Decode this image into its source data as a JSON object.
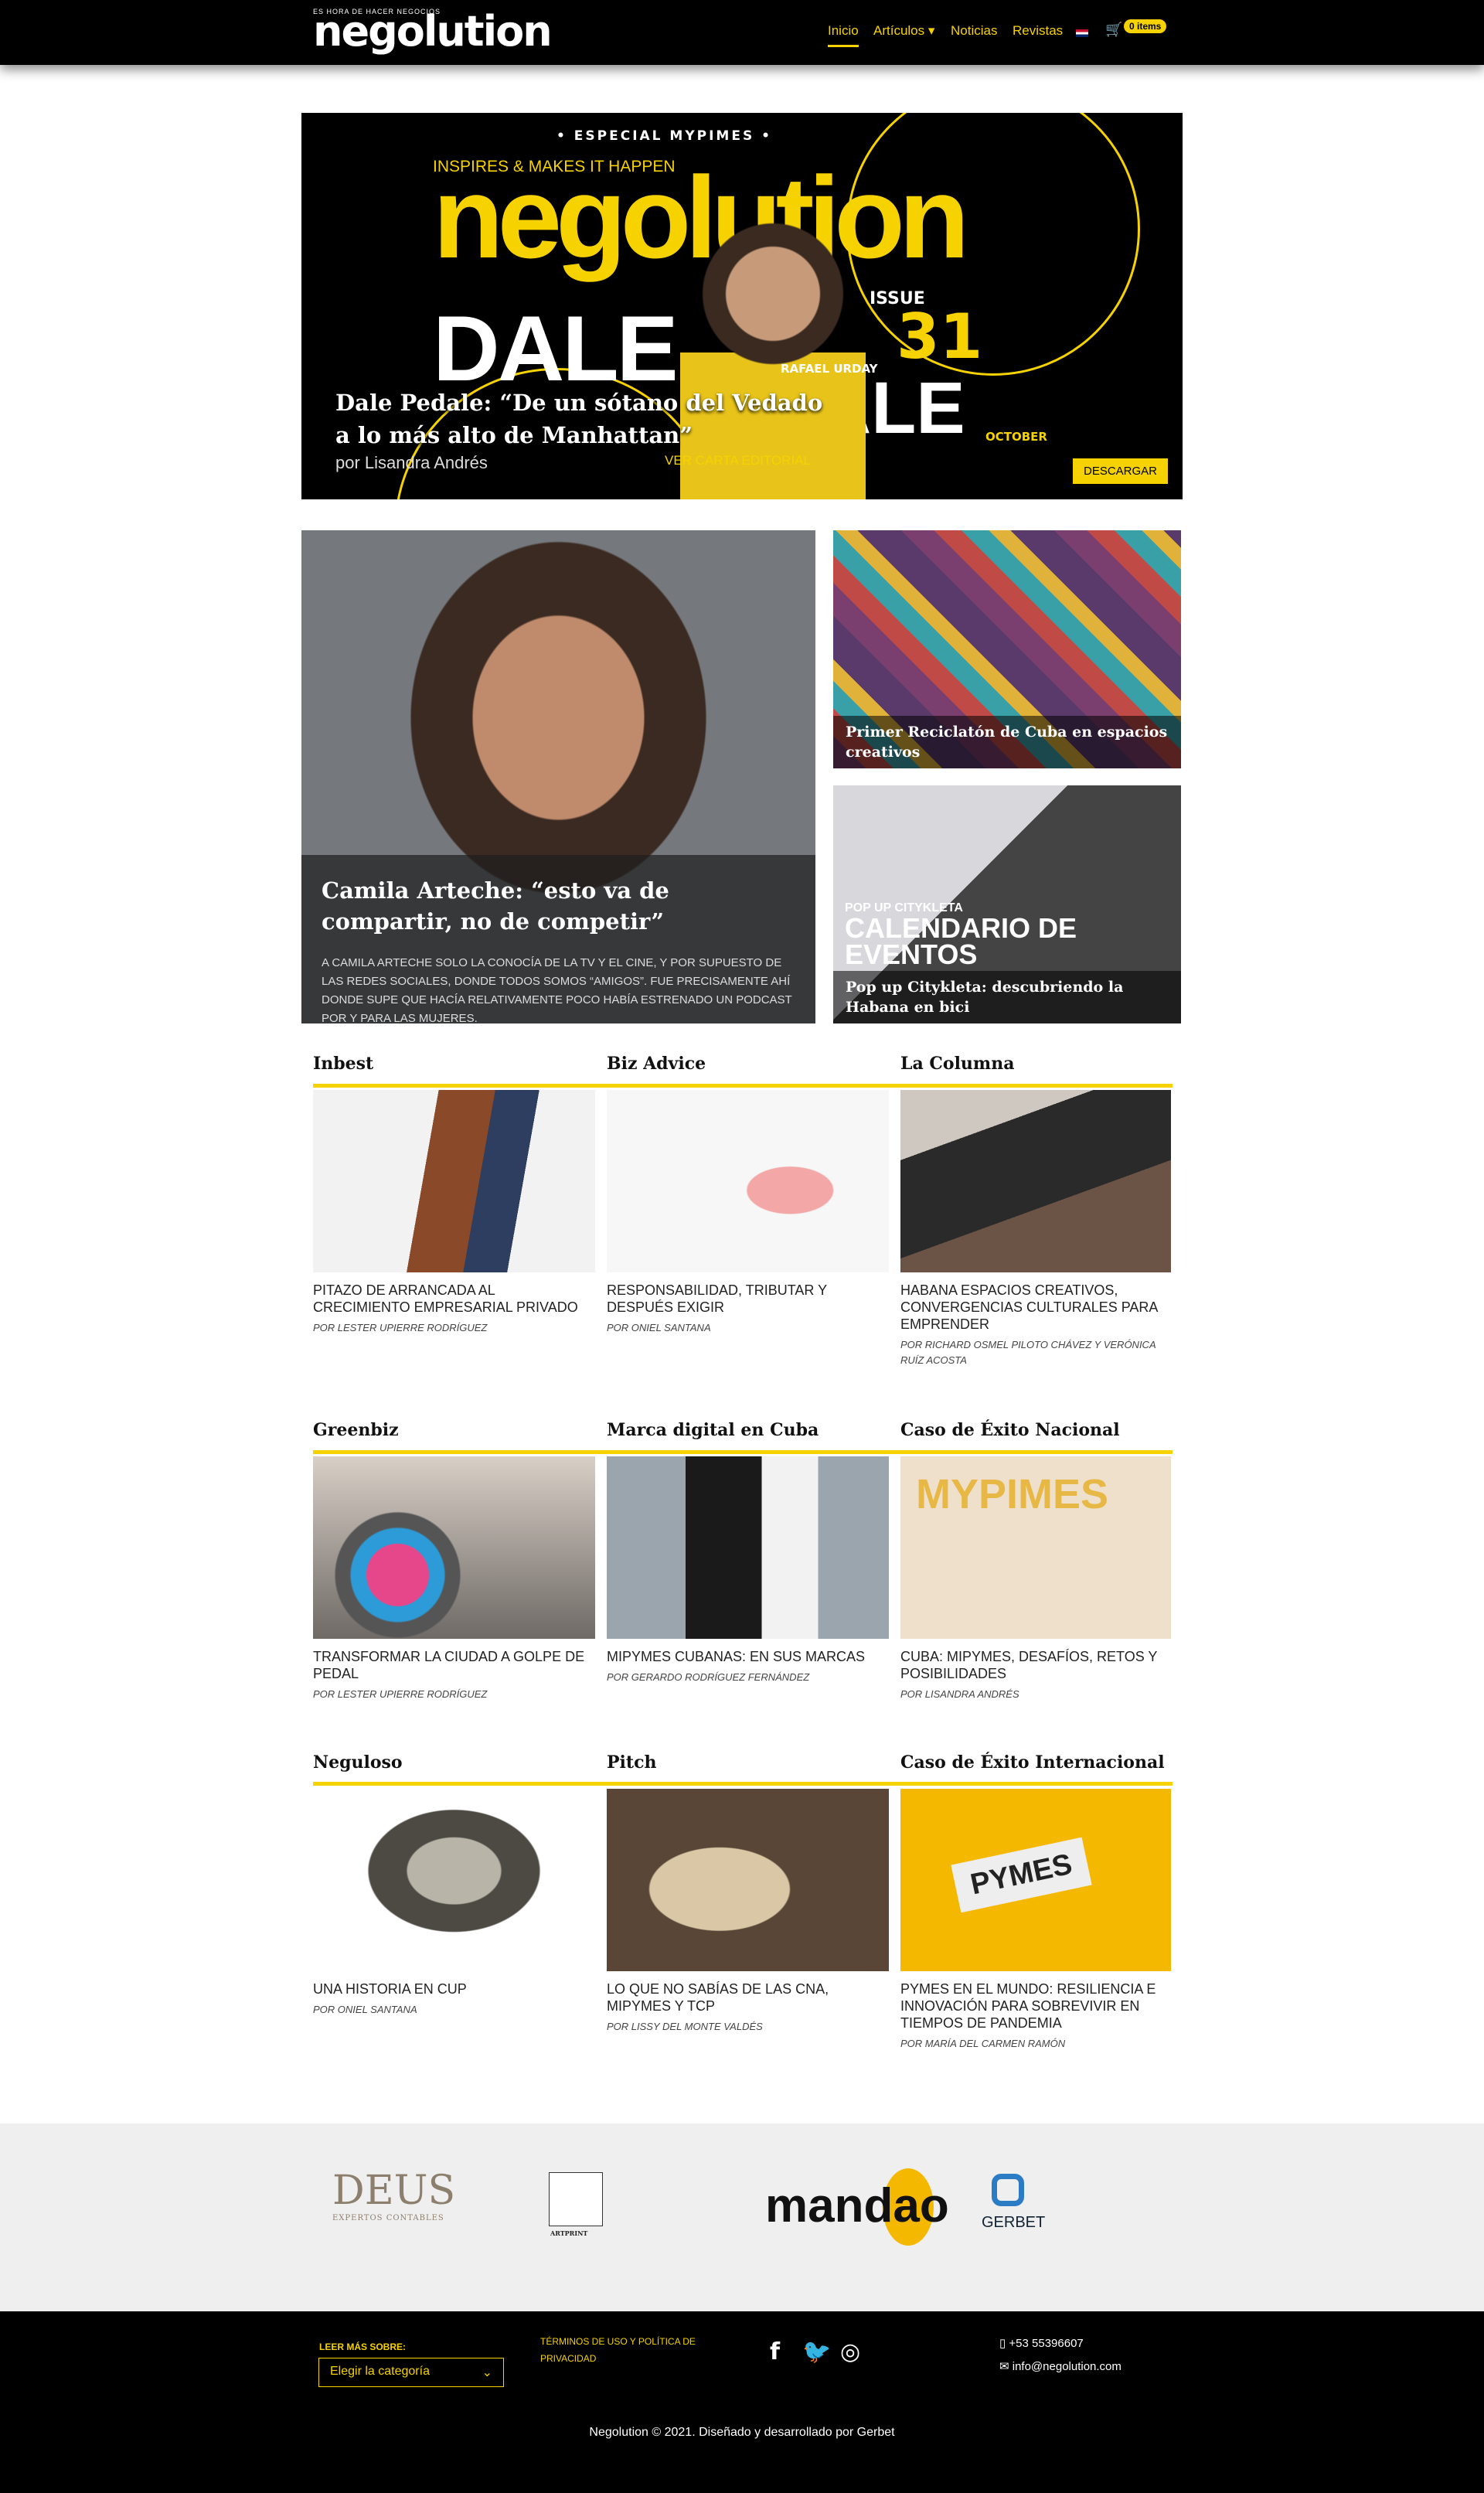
{
  "header": {
    "logo_tagline": "ES HORA DE HACER NEGOCIOS",
    "logo_word": "negolution",
    "nav": {
      "home": "Inicio",
      "articles": "Artículos ▾",
      "news": "Noticias",
      "magazines": "Revistas"
    },
    "cart_badge": "0 items"
  },
  "hero": {
    "kicker": "• ESPECIAL MYPIMES •",
    "tagline": "INSPIRES & MAKES IT HAPPEN",
    "masthead": "negolution",
    "cover_word": "DALE",
    "cover_word2": "DALE",
    "issue_label": "ISSUE",
    "issue_number": "31",
    "cover_name": "RAFAEL URDAY",
    "cover_month": "OCTOBER",
    "title": "Dale Pedale: “De un sótano del Vedado a lo más alto de Manhattan”",
    "author": "por Lisandra Andrés",
    "editorial_link": "VER CARTA EDITORIAL",
    "download_label": "DESCARGAR"
  },
  "featured": {
    "main": {
      "title": "Camila Arteche: “esto va de compartir, no de competir”",
      "excerpt": "A Camila Arteche solo la conocía de la TV y el cine, y por supuesto de las redes sociales, donde todos somos “amigos”. Fue precisamente ahí donde supe que hacía relativamente poco había estrenado un podcast por y para las mujeres."
    },
    "side1": {
      "title": "Primer Reciclatón de Cuba en espacios creativos"
    },
    "side2": {
      "overlay_small": "POP UP CITYKLETA",
      "overlay_big": "CALENDARIO DE EVENTOS",
      "title": "Pop up Citykleta: descubriendo la Habana en bici"
    }
  },
  "sections": [
    {
      "name": "Inbest",
      "headline": "Pitazo de arrancada al crecimiento empresarial privado",
      "author": "por Lester Upierre Rodríguez"
    },
    {
      "name": "Biz Advice",
      "headline": "Responsabilidad, tributar y después exigir",
      "author": "por Oniel Santana"
    },
    {
      "name": "La Columna",
      "headline": "Habana Espacios Creativos, convergencias culturales para emprender",
      "author": "por Richard Osmel Piloto Chávez y Verónica Ruíz Acosta"
    },
    {
      "name": "Greenbiz",
      "headline": "Transformar la ciudad a golpe de pedal",
      "author": "por Lester Upierre Rodríguez"
    },
    {
      "name": "Marca digital en Cuba",
      "headline": "Mipymes cubanas: en sus marcas",
      "author": "por Gerardo Rodríguez Fernández"
    },
    {
      "name": "Caso de Éxito Nacional",
      "headline": "Cuba: mipymes, desafíos, retos y posibilidades",
      "author": "por Lisandra Andrés",
      "image_text": "MYPIMES"
    },
    {
      "name": "Neguloso",
      "headline": "Una historia en CUP",
      "author": "por Oniel Santana"
    },
    {
      "name": "Pitch",
      "headline": "Lo que no sabías de las CNA, mipymes y TCP",
      "author": "por Lissy del Monte Valdés"
    },
    {
      "name": "Caso de Éxito Internacional",
      "headline": "Pymes en el mundo: resiliencia e innovación para sobrevivir en tiempos de pandemia",
      "author": "por María del Carmen Ramón",
      "image_text": "PYMES"
    }
  ],
  "partners": {
    "deus": "DEUS",
    "deus_sub": "EXPERTOS CONTABLES",
    "artprint": "ARTPRINT",
    "mandao": "mandao",
    "gerbet": "GERBET"
  },
  "footer": {
    "read_more_label": "LEER MÁS SOBRE:",
    "category_placeholder": "Elegir la categoría",
    "terms": "TÉRMINOS DE USO Y POLÍTICA DE PRIVACIDAD",
    "phone": "+53 55396607",
    "email": "info@negolution.com",
    "copyright": "Negolution © 2021. Diseñado y desarrollado por Gerbet"
  },
  "colors": {
    "accent": "#f5d200",
    "dark": "#000000"
  }
}
